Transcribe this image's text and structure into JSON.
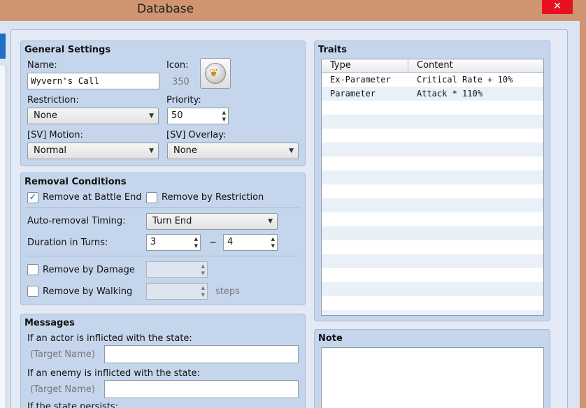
{
  "window": {
    "title": "Database",
    "close_glyph": "✕"
  },
  "general": {
    "title": "General Settings",
    "name_label": "Name:",
    "name_value": "Wyvern's Call",
    "icon_label": "Icon:",
    "icon_index": "350",
    "icon_name": "wyvern-emblem-icon",
    "restriction_label": "Restriction:",
    "restriction_value": "None",
    "priority_label": "Priority:",
    "priority_value": "50",
    "motion_label": "[SV] Motion:",
    "motion_value": "Normal",
    "overlay_label": "[SV] Overlay:",
    "overlay_value": "None"
  },
  "removal": {
    "title": "Removal Conditions",
    "battle_end_label": "Remove at Battle End",
    "battle_end_checked": true,
    "restriction_label": "Remove by Restriction",
    "restriction_checked": false,
    "timing_label": "Auto-removal Timing:",
    "timing_value": "Turn End",
    "duration_label": "Duration in Turns:",
    "duration_min": "3",
    "duration_sep": "~",
    "duration_max": "4",
    "damage_label": "Remove by Damage",
    "damage_checked": false,
    "walking_label": "Remove by Walking",
    "walking_checked": false,
    "steps_label": "steps"
  },
  "messages": {
    "title": "Messages",
    "actor_label": "If an actor is inflicted with the state:",
    "actor_target": "(Target Name)",
    "actor_value": "",
    "enemy_label": "If an enemy is inflicted with the state:",
    "enemy_target": "(Target Name)",
    "enemy_value": "",
    "persists_label": "If the state persists:"
  },
  "traits": {
    "title": "Traits",
    "columns": [
      "Type",
      "Content"
    ],
    "rows": [
      {
        "type": "Ex-Parameter",
        "content": "Critical Rate + 10%"
      },
      {
        "type": "Parameter",
        "content": "Attack * 110%"
      }
    ]
  },
  "note": {
    "title": "Note",
    "value": ""
  },
  "colors": {
    "titlebar": "#cf9470",
    "close": "#e81123",
    "panel": "#c5d6ec"
  }
}
